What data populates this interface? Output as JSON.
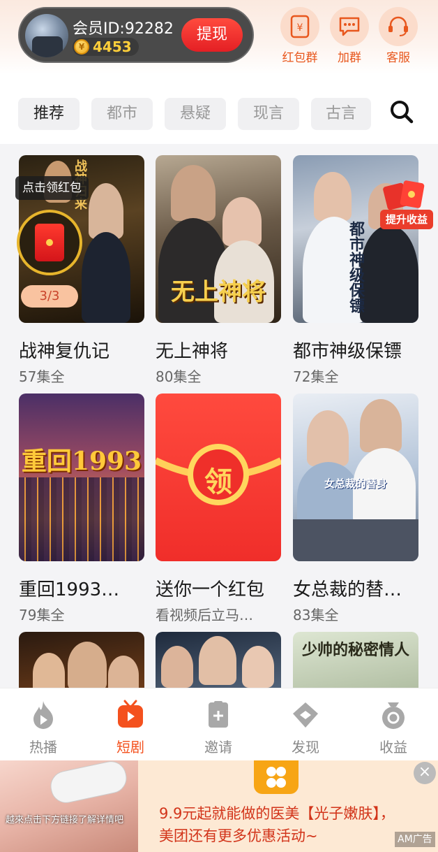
{
  "header": {
    "member_id": "会员ID:92282",
    "coins": "4453",
    "withdraw_label": "提现",
    "quick_links": [
      {
        "label": "红包群",
        "icon": "red-packet-group-icon"
      },
      {
        "label": "加群",
        "icon": "join-group-icon"
      },
      {
        "label": "客服",
        "icon": "customer-service-icon"
      }
    ]
  },
  "tabs": [
    {
      "label": "推荐",
      "active": true
    },
    {
      "label": "都市",
      "active": false
    },
    {
      "label": "悬疑",
      "active": false
    },
    {
      "label": "现言",
      "active": false
    },
    {
      "label": "古言",
      "active": false
    }
  ],
  "overlay": {
    "claim_red_packet": "点击领红包",
    "red_packet_count": "3/3",
    "boost_earnings": "提升收益"
  },
  "dramas": [
    {
      "title": "战神复仇记",
      "episodes": "57集全",
      "poster_text": "战神归来"
    },
    {
      "title": "无上神将",
      "episodes": "80集全",
      "poster_text": "无上神将"
    },
    {
      "title": "都市神级保镖",
      "episodes": "72集全",
      "poster_text": "都市神级保镖"
    },
    {
      "title": "重回1993…",
      "episodes": "79集全",
      "poster_text": "重回1993"
    },
    {
      "title": "送你一个红包",
      "episodes": "看视频后立马…",
      "poster_text": "领"
    },
    {
      "title": "女总裁的替…",
      "episodes": "83集全",
      "poster_text": "女总裁的替身"
    },
    {
      "title": "",
      "episodes": "",
      "poster_text": ""
    },
    {
      "title": "",
      "episodes": "",
      "poster_text": ""
    },
    {
      "title": "",
      "episodes": "",
      "poster_text": "少帅的秘密情人"
    }
  ],
  "bottom_nav": [
    {
      "label": "热播",
      "icon": "flame-icon",
      "active": false
    },
    {
      "label": "短剧",
      "icon": "tv-play-icon",
      "active": true
    },
    {
      "label": "邀请",
      "icon": "invite-icon",
      "active": false
    },
    {
      "label": "发现",
      "icon": "discover-icon",
      "active": false
    },
    {
      "label": "收益",
      "icon": "earnings-icon",
      "active": false
    }
  ],
  "ad": {
    "image_caption": "越來点击下方链接了解详情吧",
    "text": "9.9元起就能做的医美【光子嫩肤】，美团还有更多优惠活动~",
    "tag": "AM广告"
  },
  "colors": {
    "accent": "#f4511e",
    "withdraw": "#e41f24",
    "coin": "#ffcf3a"
  }
}
